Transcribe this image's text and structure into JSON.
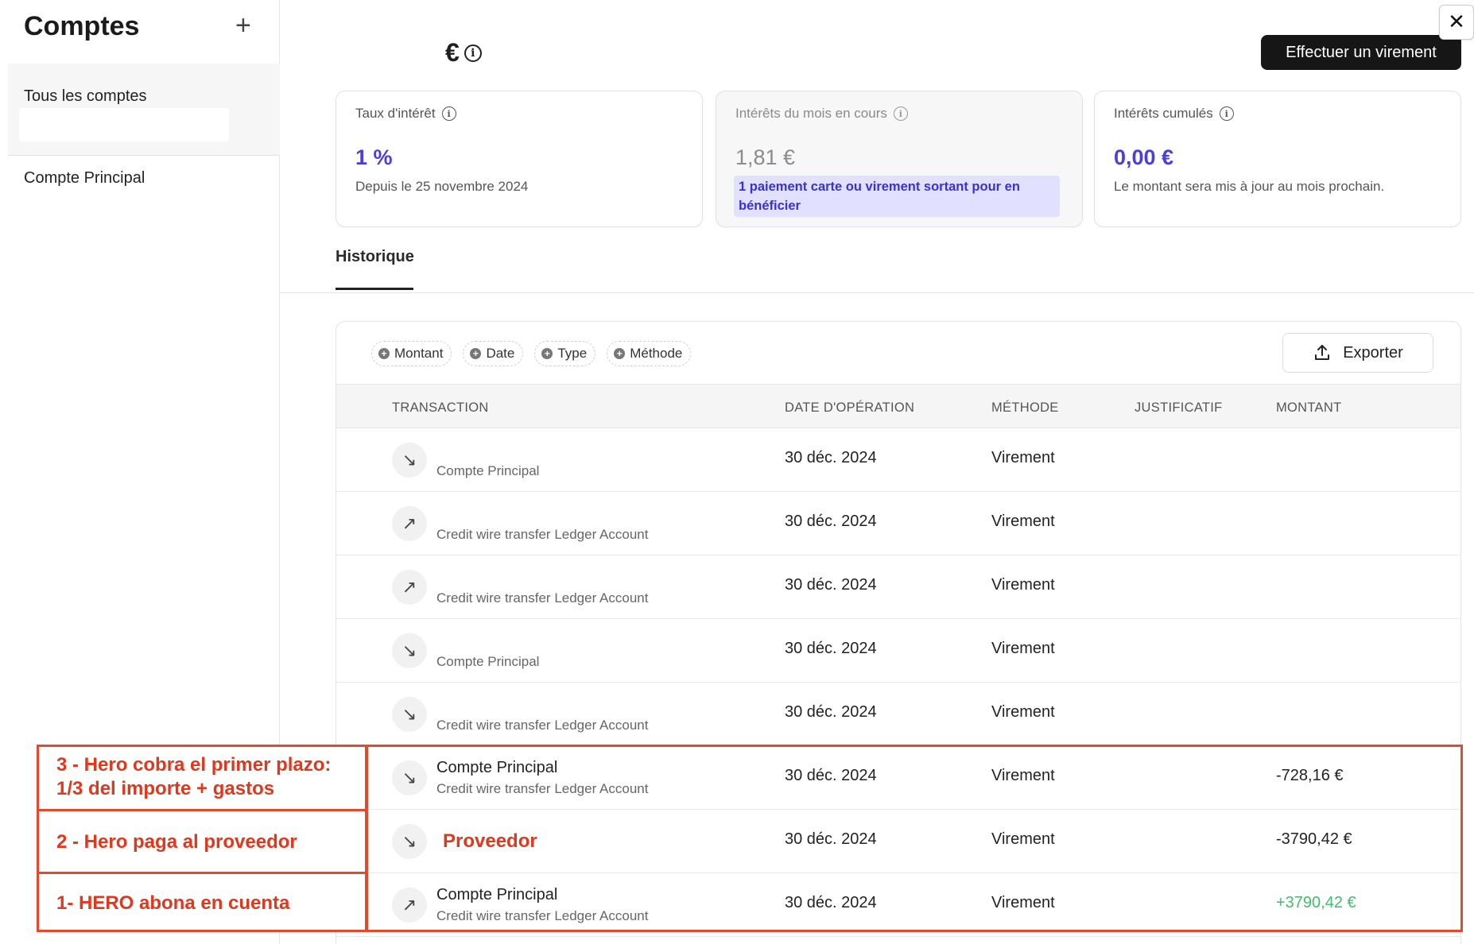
{
  "sidebar": {
    "title": "Comptes",
    "add_label": "+",
    "all_accounts": "Tous les comptes",
    "accounts": [
      "Compte Principal"
    ]
  },
  "header": {
    "balance": "€",
    "transfer_button": "Effectuer un virement",
    "close_label": "✕"
  },
  "cards": [
    {
      "title": "Taux d'intérêt",
      "value": "1 %",
      "sub": "Depuis le 25 novembre 2024"
    },
    {
      "title": "Intérêts du mois en cours",
      "value": "1,81 €",
      "badge": "1 paiement carte ou virement sortant pour en bénéficier"
    },
    {
      "title": "Intérêts cumulés",
      "value": "0,00 €",
      "sub": "Le montant sera mis à jour au mois prochain."
    }
  ],
  "tabs": [
    "Historique"
  ],
  "filters": [
    "Montant",
    "Date",
    "Type",
    "Méthode"
  ],
  "export_label": "Exporter",
  "table": {
    "headers": [
      "TRANSACTION",
      "DATE D'OPÉRATION",
      "MÉTHODE",
      "JUSTIFICATIF",
      "MONTANT"
    ],
    "rows": [
      {
        "direction": "in",
        "title": "",
        "sub": "Compte Principal",
        "date": "30 déc. 2024",
        "method": "Virement",
        "amount": ""
      },
      {
        "direction": "out",
        "title": "",
        "sub": "Credit wire transfer Ledger Account",
        "date": "30 déc. 2024",
        "method": "Virement",
        "amount": ""
      },
      {
        "direction": "out",
        "title": "",
        "sub": "Credit wire transfer Ledger Account",
        "date": "30 déc. 2024",
        "method": "Virement",
        "amount": ""
      },
      {
        "direction": "in",
        "title": "",
        "sub": "Compte Principal",
        "date": "30 déc. 2024",
        "method": "Virement",
        "amount": ""
      },
      {
        "direction": "in",
        "title": "",
        "sub": "Credit wire transfer Ledger Account",
        "date": "30 déc. 2024",
        "method": "Virement",
        "amount": ""
      },
      {
        "direction": "in",
        "title": "Compte Principal",
        "sub": "Credit wire transfer Ledger Account",
        "date": "30 déc. 2024",
        "method": "Virement",
        "amount": "-728,16 €"
      },
      {
        "direction": "in",
        "title": "",
        "sub": "",
        "provider": "Proveedor",
        "date": "30 déc. 2024",
        "method": "Virement",
        "amount": "-3790,42 €"
      },
      {
        "direction": "out",
        "title": "Compte Principal",
        "sub": "Credit wire transfer Ledger Account",
        "date": "30 déc. 2024",
        "method": "Virement",
        "amount": "+3790,42 €"
      }
    ]
  },
  "annotations": [
    "3 - Hero cobra el primer plazo: 1/3 del importe + gastos",
    "2 - Hero paga al proveedor",
    "1- HERO abona en cuenta"
  ],
  "colors": {
    "accent": "#4a3ee0",
    "annotation": "#e0371d",
    "positive": "#3fbe6e"
  }
}
